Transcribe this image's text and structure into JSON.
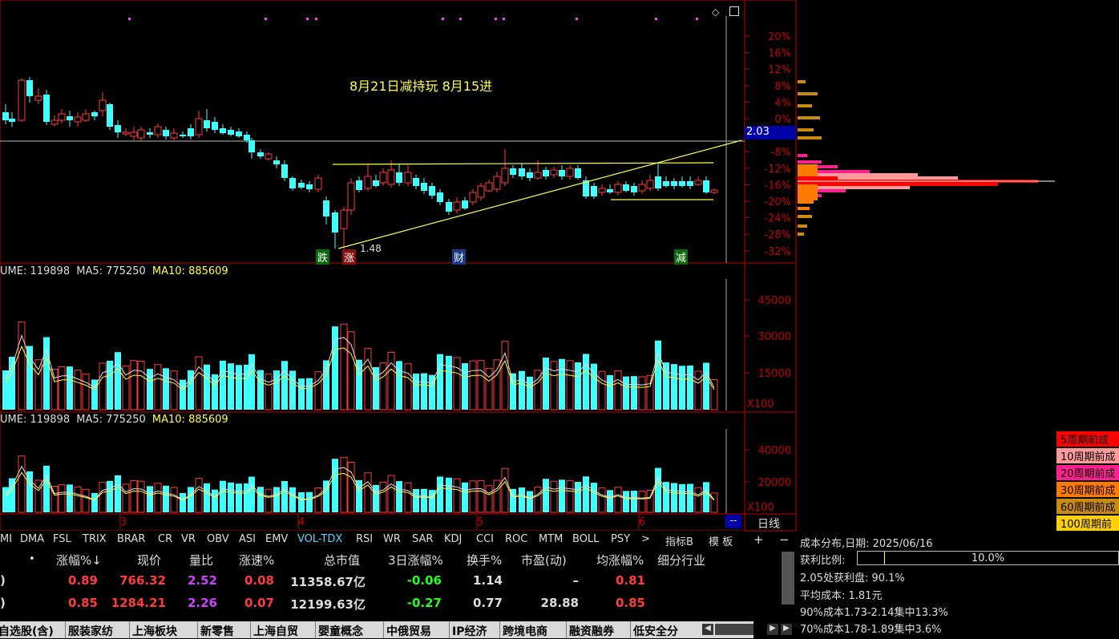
{
  "chart_data": [
    {
      "type": "candlestick",
      "title": "",
      "yticks": [
        "20%",
        "16%",
        "12%",
        "8%",
        "4%",
        "0%",
        "-4%",
        "-8%",
        "-12%",
        "-16%",
        "-20%",
        "-24%",
        "-28%",
        "-32%"
      ],
      "current_price_label": "2.03",
      "low_label": "1.48",
      "annotation": "8月21日减持玩 8月15进",
      "markers": [
        "跌",
        "涨",
        "财",
        "减"
      ],
      "x_month_labels": [
        "3",
        "4",
        "5",
        "6"
      ],
      "grid": false
    },
    {
      "type": "bar",
      "title": "UME: 119898 MA5: 775250 MA10: 885609",
      "yticks": [
        "45000",
        "30000",
        "15000"
      ],
      "unit": "X100"
    },
    {
      "type": "bar",
      "title": "UME: 119898 MA5: 775250 MA10: 885609",
      "yticks": [
        "40000",
        "20000"
      ],
      "unit": "X100"
    }
  ],
  "vol_panel1": {
    "p1": "UME: 119898",
    "p2": "MA5: 775250",
    "p3": "MA10: 885609"
  },
  "vol_panel2": {
    "p1": "UME: 119898",
    "p2": "MA5: 775250",
    "p3": "MA10: 885609"
  },
  "indicators": [
    "MI",
    "DMA",
    "FSL",
    "TRIX",
    "BRAR",
    "CR",
    "VR",
    "OBV",
    "ASI",
    "EMV",
    "VOL-TDX",
    "RSI",
    "WR",
    "SAR",
    "KDJ",
    "CCI",
    "ROC",
    "MTM",
    "BOLL",
    "PSY",
    ">",
    "指标B",
    "模 板"
  ],
  "period": {
    "plus": "+",
    "minus": "−",
    "label": "日线"
  },
  "table": {
    "dot": "•",
    "headers": [
      "涨幅%↓",
      "现价",
      "量比",
      "涨速%",
      "总市值",
      "3日涨幅%",
      "换手%",
      "市盈(动)",
      "均涨幅%",
      "细分行业"
    ],
    "rows": [
      [
        "0.89",
        "766.32",
        "2.52",
        "0.08",
        "11358.67亿",
        "-0.06",
        "1.14",
        "–",
        "0.81",
        ""
      ],
      [
        "0.85",
        "1284.21",
        "2.26",
        "0.07",
        "12199.63亿",
        "-0.27",
        "0.77",
        "28.88",
        "0.85",
        ""
      ]
    ]
  },
  "tabs": [
    "自选股(含)",
    "服装家纺",
    "上海板块",
    "新零售",
    "上海自贸",
    "婴童概念",
    "中俄贸易",
    "IP经济",
    "跨境电商",
    "融资融券",
    "低安全分"
  ],
  "cost": {
    "title": "成本分布,日期: 2025/06/16",
    "profit_label": "获利比例:",
    "profit_value": "10.0%",
    "profit_fraction": 0.1,
    "line1": "2.05处获利盘: 90.1%",
    "line2": "平均成本: 1.81元",
    "line3": "90%成本1.73-2.14集中13.3%",
    "line4": "70%成本1.78-1.89集中3.6%"
  },
  "legend": [
    {
      "label": "5周期前成",
      "color": "#ff0000"
    },
    {
      "label": "10周期前成",
      "color": "#ff9a9a"
    },
    {
      "label": "20周期前成",
      "color": "#ff2090"
    },
    {
      "label": "30周期前成",
      "color": "#ff7a00"
    },
    {
      "label": "60周期前成",
      "color": "#c88a10"
    },
    {
      "label": "100周期前",
      "color": "#ffd000"
    }
  ],
  "colors": {
    "up": "#ff3b3b",
    "down": "#40ffff",
    "ma": "#ffff40",
    "axis": "#c00000"
  }
}
